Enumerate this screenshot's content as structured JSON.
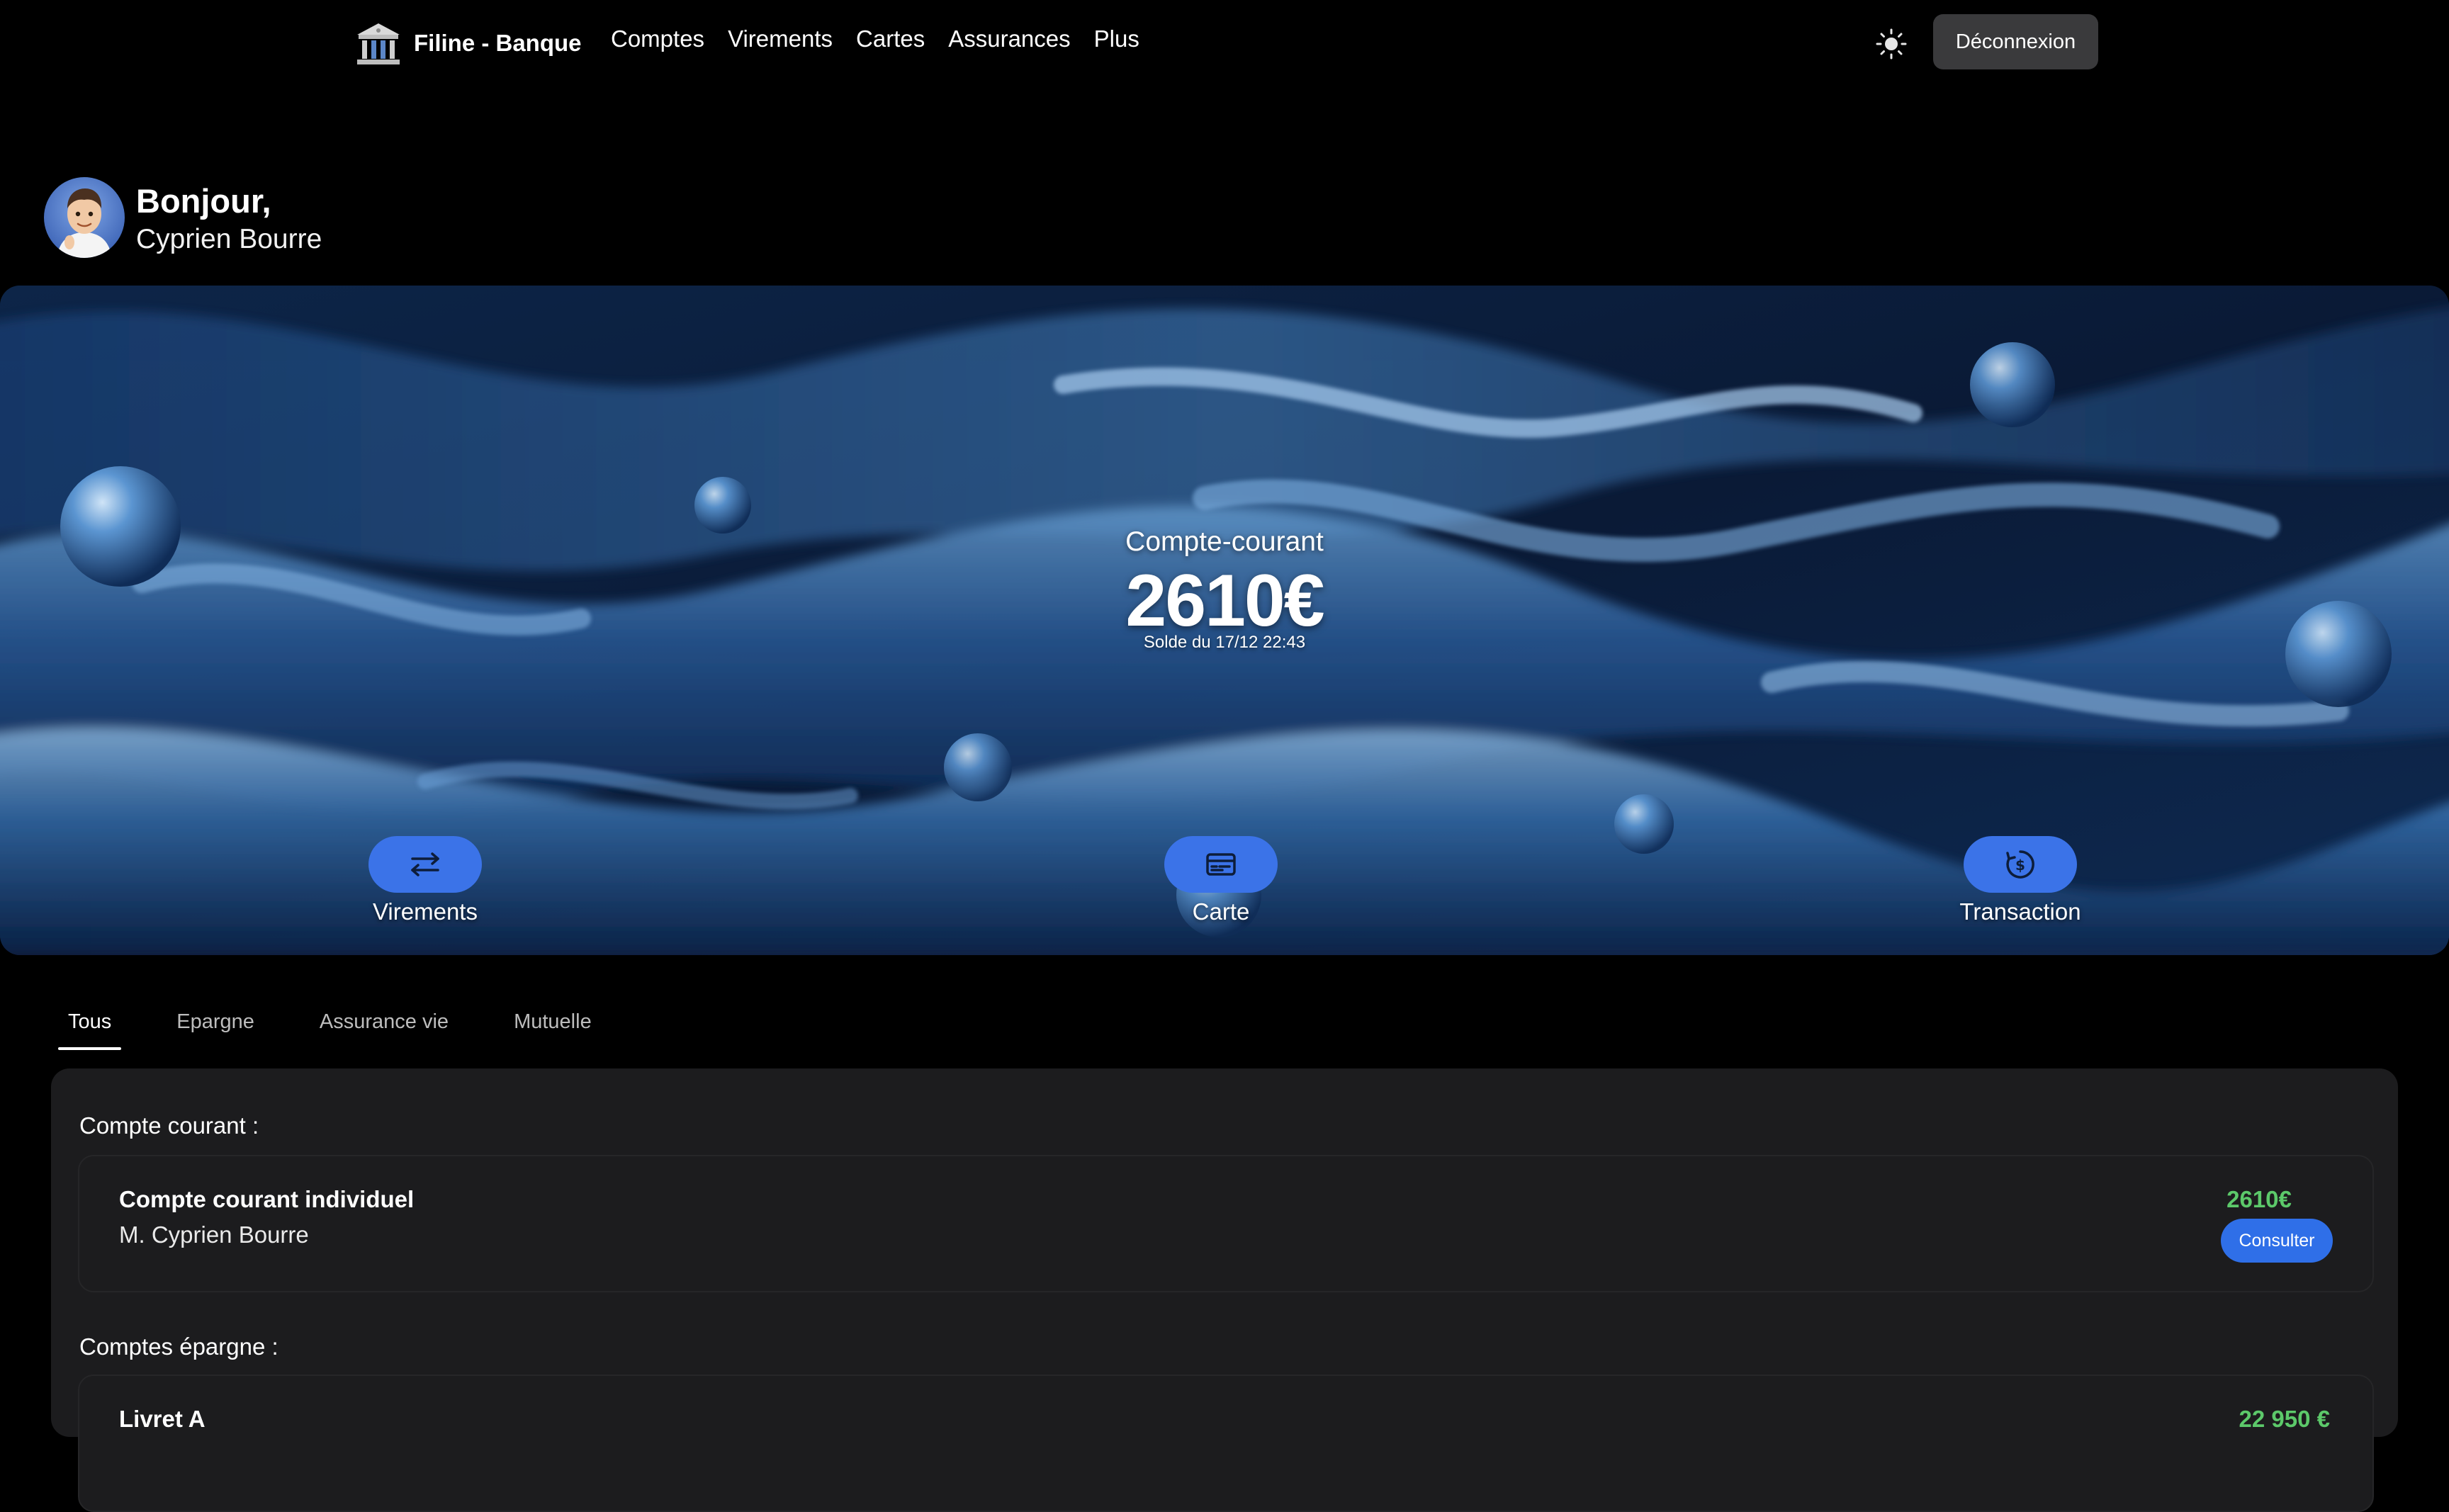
{
  "navbar": {
    "brand": "Filine - Banque",
    "brand_icon": "bank-building-icon",
    "links": [
      "Comptes",
      "Virements",
      "Cartes",
      "Assurances",
      "Plus"
    ],
    "theme_icon": "sun-icon",
    "logout_label": "Déconnexion"
  },
  "greeting": {
    "title": "Bonjour,",
    "name": "Cyprien Bourre"
  },
  "hero": {
    "account_label": "Compte-courant",
    "balance": "2610€",
    "balance_date": "Solde du 17/12 22:43",
    "actions": [
      {
        "label": "Virements",
        "icon": "transfer-arrows-icon"
      },
      {
        "label": "Carte",
        "icon": "credit-card-icon"
      },
      {
        "label": "Transaction",
        "icon": "dollar-coin-icon"
      }
    ]
  },
  "tabs": [
    "Tous",
    "Epargne",
    "Assurance vie",
    "Mutuelle"
  ],
  "active_tab": "Tous",
  "accounts": {
    "checking_title": "Compte courant :",
    "checking": {
      "name": "Compte courant individuel",
      "owner": "M. Cyprien Bourre",
      "amount": "2610€",
      "button": "Consulter"
    },
    "savings_title": "Comptes épargne :",
    "savings": {
      "name": "Livret A",
      "amount": "22 950 €"
    }
  },
  "colors": {
    "background": "#000000",
    "panel": "#1c1c1e",
    "accent": "#3b73e8",
    "positive": "#5cc96a",
    "logout_bg": "#3a3a3c"
  }
}
